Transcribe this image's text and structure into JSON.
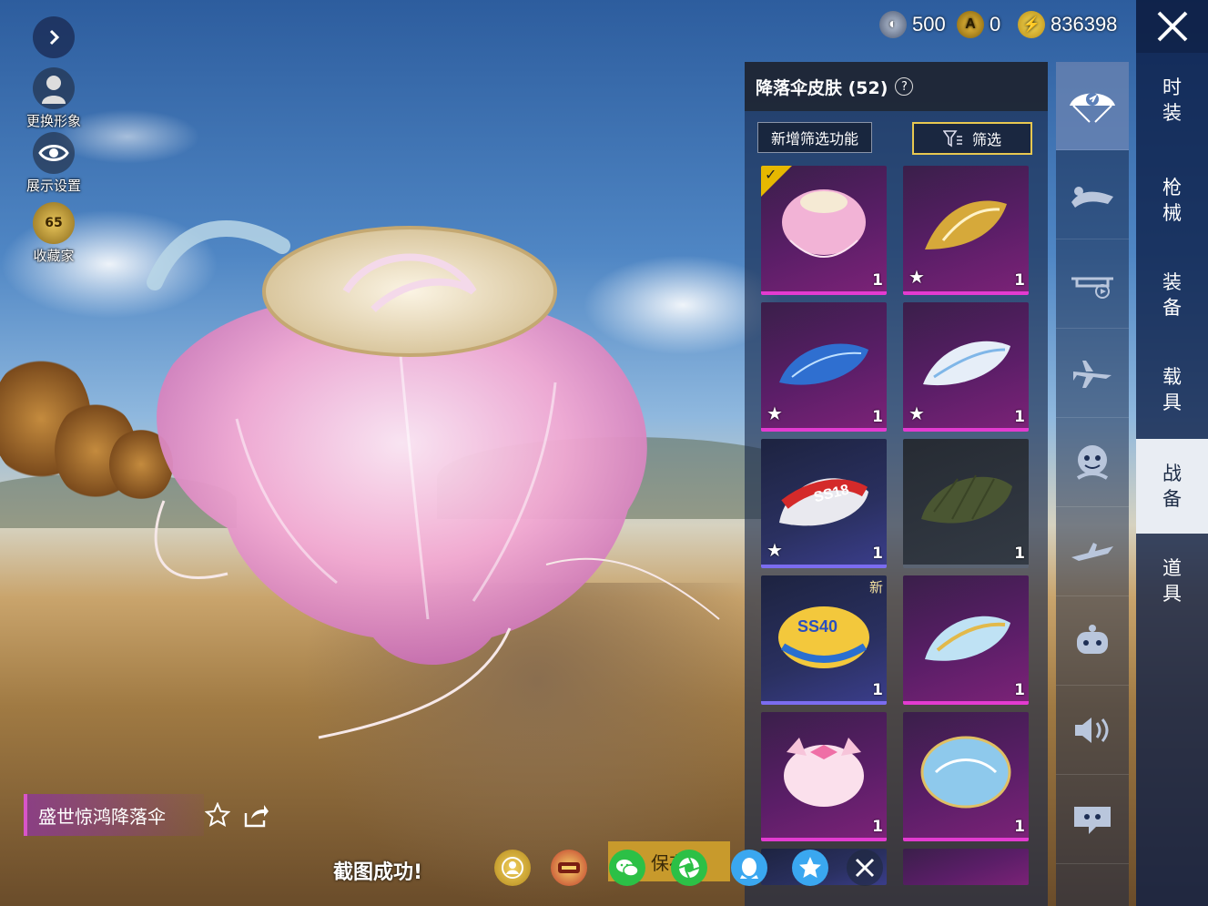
{
  "currency": {
    "silver_value": "500",
    "ucoin_value": "0",
    "bp_value": "836398"
  },
  "left_menu": {
    "change_avatar": "更换形象",
    "display_settings": "展示设置",
    "collector_level": "65",
    "collector": "收藏家"
  },
  "panel": {
    "title": "降落伞皮肤 (52)",
    "help": "?",
    "new_filter": "新增筛选功能",
    "filter": "筛选"
  },
  "items": [
    {
      "qty": "1",
      "rarity": "purple",
      "selected": true,
      "star": false,
      "new": false,
      "art": "pink-jellyfish-chute"
    },
    {
      "qty": "1",
      "rarity": "purple",
      "selected": false,
      "star": true,
      "new": false,
      "art": "gold-wing-chute"
    },
    {
      "qty": "1",
      "rarity": "purple",
      "selected": false,
      "star": true,
      "new": false,
      "art": "blue-feather-chute"
    },
    {
      "qty": "1",
      "rarity": "purple",
      "selected": false,
      "star": true,
      "new": false,
      "art": "white-blue-chute"
    },
    {
      "qty": "1",
      "rarity": "blue",
      "selected": false,
      "star": true,
      "new": false,
      "art": "ss18-chute",
      "logo": "SS18"
    },
    {
      "qty": "1",
      "rarity": "grey",
      "selected": false,
      "star": false,
      "new": false,
      "art": "olive-standard-chute"
    },
    {
      "qty": "1",
      "rarity": "blue",
      "selected": false,
      "star": false,
      "new": true,
      "new_label": "新",
      "art": "ss40-chute",
      "logo": "SS40"
    },
    {
      "qty": "1",
      "rarity": "purple",
      "selected": false,
      "star": false,
      "new": false,
      "art": "blue-gold-chute"
    },
    {
      "qty": "1",
      "rarity": "purple",
      "selected": false,
      "star": false,
      "new": false,
      "art": "pink-bow-chute"
    },
    {
      "qty": "1",
      "rarity": "purple",
      "selected": false,
      "star": false,
      "new": false,
      "art": "blue-dome-chute"
    }
  ],
  "category_icons": [
    "parachute-icon",
    "skydive-icon",
    "drone-icon",
    "plane-icon",
    "emote-icon",
    "glider-icon",
    "companion-icon",
    "voice-icon",
    "chat-icon"
  ],
  "tabs": [
    {
      "label": "时装"
    },
    {
      "label": "枪械"
    },
    {
      "label": "装备"
    },
    {
      "label": "载具"
    },
    {
      "label": "战备"
    },
    {
      "label": "道具"
    }
  ],
  "bottom": {
    "item_name": "盛世惊鸿降落伞",
    "toast": "截图成功!",
    "save_text": "保存"
  },
  "colors": {
    "selected_check": "#e6b800",
    "purple_rarity": "#e33bd0",
    "blue_rarity": "#7b6cf0",
    "filter_border": "#e8c850"
  }
}
